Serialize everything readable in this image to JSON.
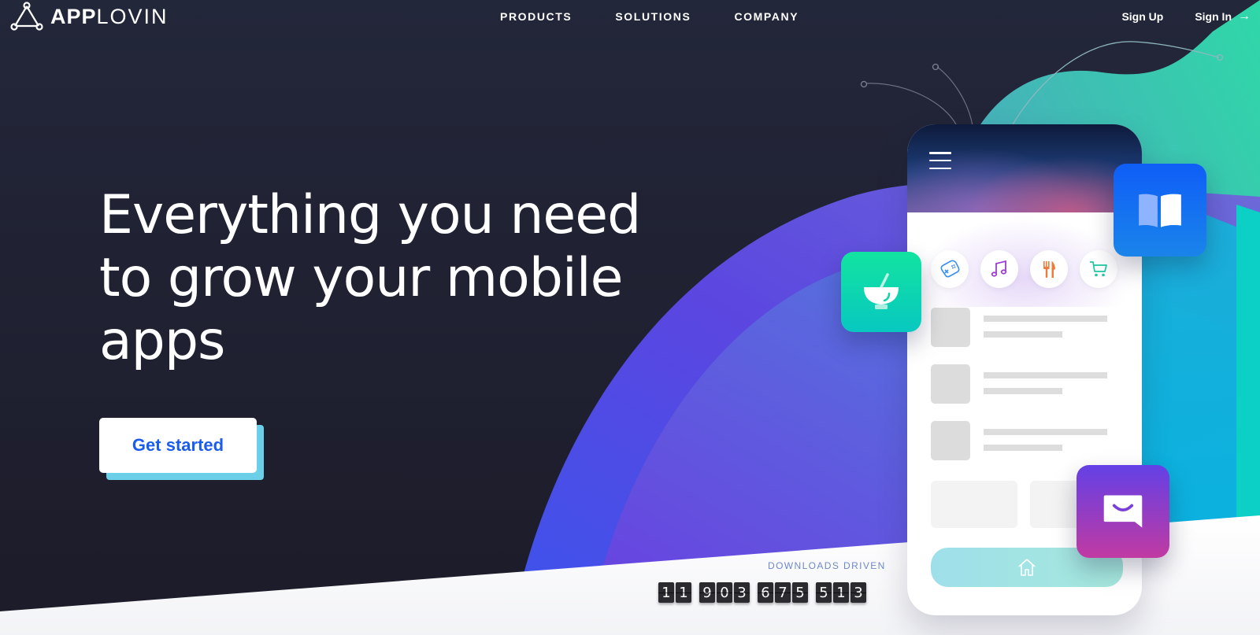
{
  "brand": {
    "name_bold": "APP",
    "name_light": "LOVIN",
    "logo_icon": "triangle-nodes-icon"
  },
  "nav": {
    "links": [
      {
        "label": "PRODUCTS"
      },
      {
        "label": "SOLUTIONS"
      },
      {
        "label": "COMPANY"
      }
    ],
    "sign_up": "Sign Up",
    "sign_in": "Sign In",
    "sign_in_icon": "arrow-right-icon",
    "sign_in_arrow": "→"
  },
  "hero": {
    "headline_lines": [
      "Everything you need",
      "to grow your mobile",
      "apps"
    ],
    "cta_label": "Get started"
  },
  "counter": {
    "label": "DOWNLOADS DRIVEN",
    "value": "11,903,675,513",
    "groups": [
      [
        "1",
        "1"
      ],
      [
        "9",
        "0",
        "3"
      ],
      [
        "6",
        "7",
        "5"
      ],
      [
        "5",
        "1",
        "3"
      ]
    ]
  },
  "phone": {
    "menu_icon": "hamburger-menu-icon",
    "categories": [
      {
        "icon": "gamepad-icon",
        "color": "#3b8ff0"
      },
      {
        "icon": "music-note-icon",
        "color": "#9a3fd0"
      },
      {
        "icon": "fork-knife-icon",
        "color": "#f07a3a"
      },
      {
        "icon": "shopping-cart-icon",
        "color": "#1fc9a2"
      }
    ],
    "home_icon": "home-icon"
  },
  "floating_apps": [
    {
      "icon": "open-book-icon",
      "color_top": "#0f5ef7",
      "color_bottom": "#1a84ea"
    },
    {
      "icon": "bowl-spoon-icon",
      "color_top": "#12e3a0",
      "color_bottom": "#08c8c0"
    },
    {
      "icon": "chat-smile-icon",
      "color_top": "#6340e6",
      "color_bottom": "#c13aa2"
    }
  ],
  "colors": {
    "background_dark": "#21243a",
    "cta_text": "#1a5cf0",
    "cta_shadow": "#6bcfe8",
    "counter_label": "#7088c6"
  }
}
